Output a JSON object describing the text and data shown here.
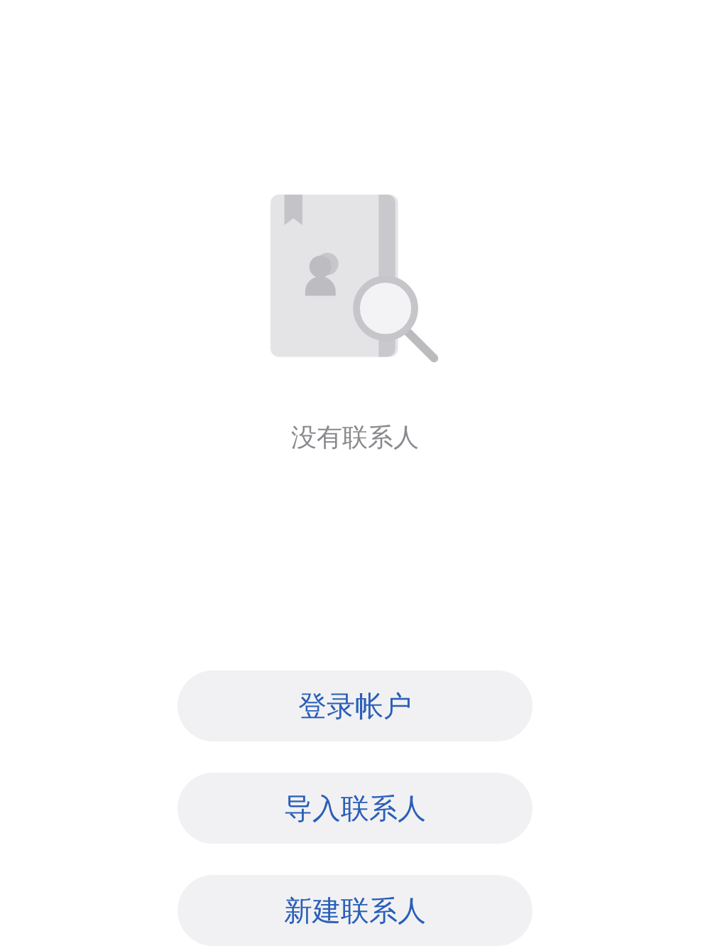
{
  "empty_state": {
    "message": "没有联系人"
  },
  "buttons": [
    {
      "label": "登录帐户"
    },
    {
      "label": "导入联系人"
    },
    {
      "label": "新建联系人"
    }
  ]
}
